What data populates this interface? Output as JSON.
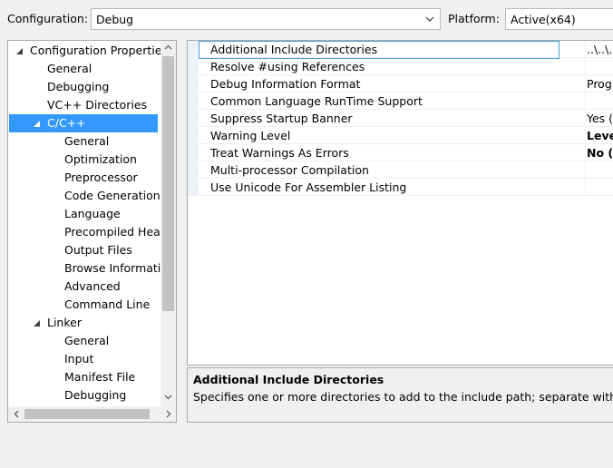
{
  "toolbar": {
    "configuration_label": "Configuration:",
    "configuration_value": "Debug",
    "platform_label": "Platform:",
    "platform_value": "Active(x64)"
  },
  "tree": {
    "items": [
      {
        "label": "Configuration Properties",
        "level": 0,
        "expanded": true
      },
      {
        "label": "General",
        "level": 1
      },
      {
        "label": "Debugging",
        "level": 1
      },
      {
        "label": "VC++ Directories",
        "level": 1
      },
      {
        "label": "C/C++",
        "level": 1,
        "expanded": true,
        "selected": true
      },
      {
        "label": "General",
        "level": 2
      },
      {
        "label": "Optimization",
        "level": 2
      },
      {
        "label": "Preprocessor",
        "level": 2
      },
      {
        "label": "Code Generation",
        "level": 2
      },
      {
        "label": "Language",
        "level": 2
      },
      {
        "label": "Precompiled Headers",
        "level": 2
      },
      {
        "label": "Output Files",
        "level": 2
      },
      {
        "label": "Browse Information",
        "level": 2
      },
      {
        "label": "Advanced",
        "level": 2
      },
      {
        "label": "Command Line",
        "level": 2
      },
      {
        "label": "Linker",
        "level": 1,
        "expanded": true
      },
      {
        "label": "General",
        "level": 2
      },
      {
        "label": "Input",
        "level": 2
      },
      {
        "label": "Manifest File",
        "level": 2
      },
      {
        "label": "Debugging",
        "level": 2
      }
    ]
  },
  "properties": {
    "rows": [
      {
        "name": "Additional Include Directories",
        "value": "..\\..\\..",
        "bold": false,
        "focused": true
      },
      {
        "name": "Resolve #using References",
        "value": "",
        "bold": false
      },
      {
        "name": "Debug Information Format",
        "value": "Prog",
        "bold": false
      },
      {
        "name": "Common Language RunTime Support",
        "value": "",
        "bold": false
      },
      {
        "name": "Suppress Startup Banner",
        "value": "Yes (",
        "bold": false
      },
      {
        "name": "Warning Level",
        "value": "Leve",
        "bold": true
      },
      {
        "name": "Treat Warnings As Errors",
        "value": "No (/",
        "bold": true
      },
      {
        "name": "Multi-processor Compilation",
        "value": "",
        "bold": false
      },
      {
        "name": "Use Unicode For Assembler Listing",
        "value": "",
        "bold": false
      }
    ]
  },
  "description": {
    "title": "Additional Include Directories",
    "text": "Specifies one or more directories to add to the include path; separate with semi-colons."
  },
  "icons": {
    "combo_arrow": "chevron-down-icon",
    "tree_expander": "triangle-expanded-icon",
    "scroll_up": "scroll-up-arrow-icon",
    "scroll_down": "scroll-down-arrow-icon",
    "scroll_left": "scroll-left-arrow-icon",
    "scroll_right": "scroll-right-arrow-icon"
  },
  "colors": {
    "selection": "#3399ff",
    "focus_border": "#4aa0d8",
    "window_bg": "#f0f0f0"
  }
}
